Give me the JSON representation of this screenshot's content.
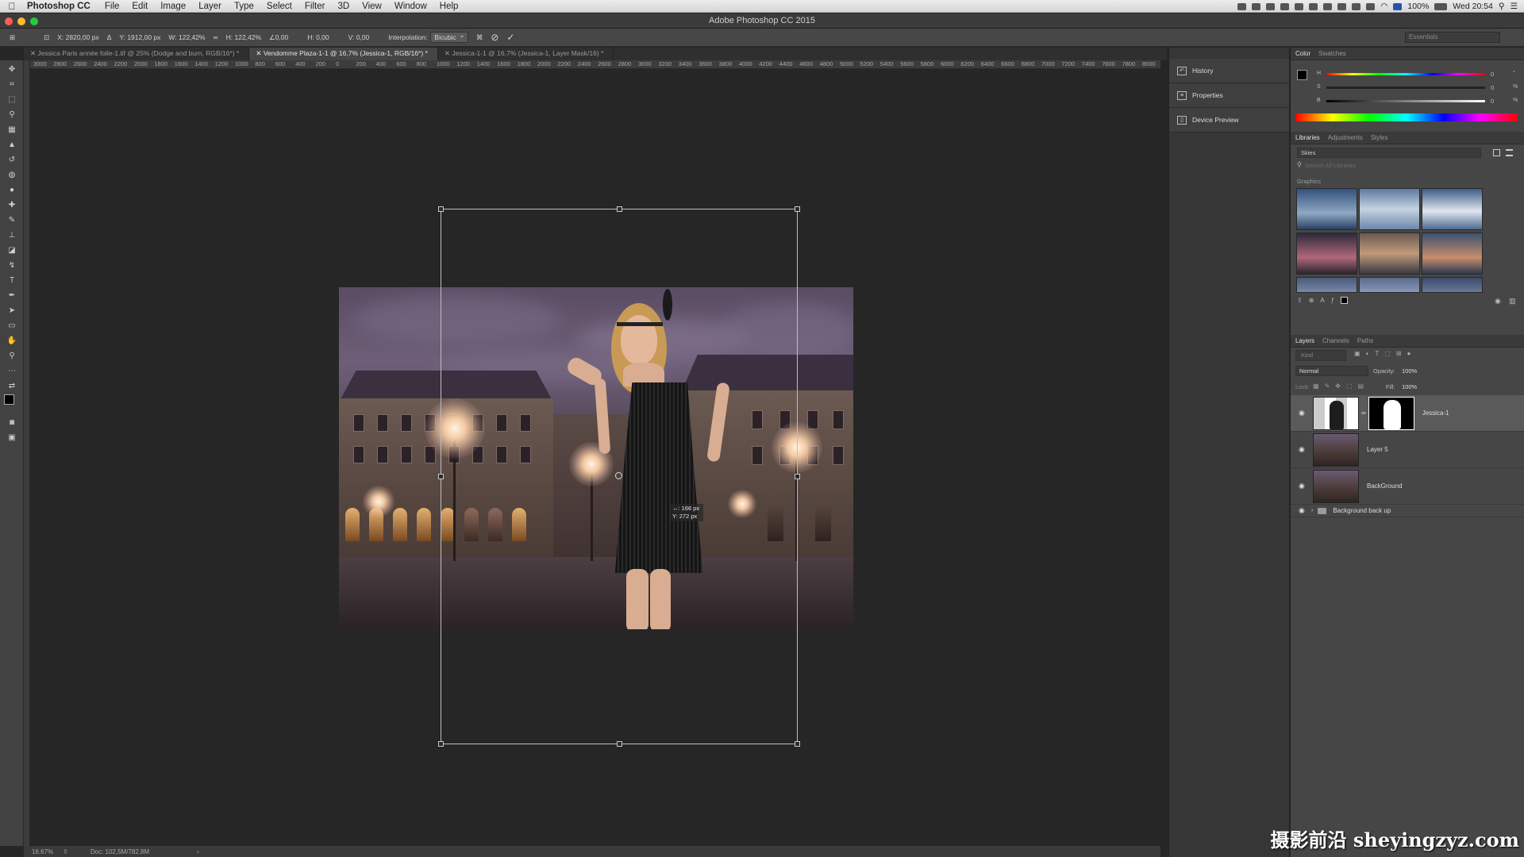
{
  "menubar": {
    "app": "Photoshop CC",
    "items": [
      "File",
      "Edit",
      "Image",
      "Layer",
      "Type",
      "Select",
      "Filter",
      "3D",
      "View",
      "Window",
      "Help"
    ],
    "battery": "100%",
    "clock": "Wed 20:54"
  },
  "window": {
    "title": "Adobe Photoshop CC 2015"
  },
  "options": {
    "x": "X: 2820,00 px",
    "y": "Y: 1912,00 px",
    "w": "W: 122,42%",
    "h": "H: 122,42%",
    "angle": "0,00",
    "hskew": "H: 0,00",
    "vskew": "V: 0,00",
    "interpolation_label": "Interpolation:",
    "interpolation_value": "Bicubic",
    "workspace": "Essentials"
  },
  "tabs": [
    "Jessica Paris année folle-1.tif @ 25% (Dodge and burn, RGB/16*) *",
    "Vendomme Plaza-1-1 @ 16,7% (Jessica-1, RGB/16*) *",
    "Jessica-1-1 @ 16,7% (Jessica-1, Layer Mask/16) *"
  ],
  "ruler": [
    "3000",
    "2800",
    "2600",
    "2400",
    "2200",
    "2000",
    "1800",
    "1600",
    "1400",
    "1200",
    "1000",
    "800",
    "600",
    "400",
    "200",
    "0",
    "200",
    "400",
    "600",
    "800",
    "1000",
    "1200",
    "1400",
    "1600",
    "1800",
    "2000",
    "2200",
    "2400",
    "2600",
    "2800",
    "3000",
    "3200",
    "3400",
    "3600",
    "3800",
    "4000",
    "4200",
    "4400",
    "4600",
    "4800",
    "5000",
    "5200",
    "5400",
    "5600",
    "5800",
    "6000",
    "6200",
    "6400",
    "6600",
    "6800",
    "7000",
    "7200",
    "7400",
    "7600",
    "7800",
    "8000",
    "8200"
  ],
  "transform_tip": {
    "w": "↔: 166 px",
    "h": "Y: 272 px"
  },
  "status": {
    "zoom": "16.67%",
    "doc": "Doc: 102,5M/782,8M"
  },
  "mid_panels": [
    "History",
    "Properties",
    "Device Preview"
  ],
  "color_panel": {
    "tabs": [
      "Color",
      "Swatches"
    ],
    "sliders": [
      {
        "label": "H",
        "value": "0",
        "unit": "°"
      },
      {
        "label": "S",
        "value": "0",
        "unit": "%"
      },
      {
        "label": "B",
        "value": "0",
        "unit": "%"
      }
    ]
  },
  "libraries": {
    "tabs": [
      "Libraries",
      "Adjustments",
      "Styles"
    ],
    "library": "Skies",
    "search_placeholder": "Search All Libraries",
    "section": "Graphics"
  },
  "layers_panel": {
    "tabs": [
      "Layers",
      "Channels",
      "Paths"
    ],
    "kind": "Kind",
    "blend": "Normal",
    "opacity_label": "Opacity:",
    "opacity": "100%",
    "lock_label": "Lock:",
    "fill_label": "Fill:",
    "fill": "100%",
    "layers": [
      "Jessica-1",
      "Layer 5",
      "BackGround",
      "Background back up"
    ]
  },
  "watermark": "摄影前沿 sheyingzyz.com"
}
